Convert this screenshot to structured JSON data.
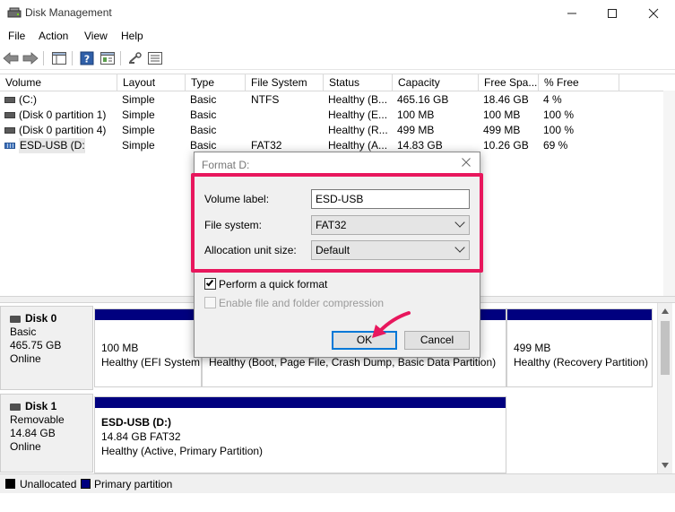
{
  "window": {
    "title": "Disk Management",
    "controls": [
      "minimize",
      "maximize",
      "close"
    ]
  },
  "menu": [
    "File",
    "Action",
    "View",
    "Help"
  ],
  "toolbar": {
    "icons": [
      "back-icon",
      "forward-icon",
      "console-tree-icon",
      "help-icon",
      "properties-icon",
      "key-icon",
      "list-view-icon"
    ]
  },
  "volume_list": {
    "columns": [
      "Volume",
      "Layout",
      "Type",
      "File System",
      "Status",
      "Capacity",
      "Free Spa...",
      "% Free"
    ],
    "rows": [
      {
        "volume": "(C:)",
        "layout": "Simple",
        "type": "Basic",
        "fs": "NTFS",
        "status": "Healthy (B...",
        "capacity": "465.16 GB",
        "free": "18.46 GB",
        "pct": "4 %"
      },
      {
        "volume": "(Disk 0 partition 1)",
        "layout": "Simple",
        "type": "Basic",
        "fs": "",
        "status": "Healthy (E...",
        "capacity": "100 MB",
        "free": "100 MB",
        "pct": "100 %"
      },
      {
        "volume": "(Disk 0 partition 4)",
        "layout": "Simple",
        "type": "Basic",
        "fs": "",
        "status": "Healthy (R...",
        "capacity": "499 MB",
        "free": "499 MB",
        "pct": "100 %"
      },
      {
        "volume": "ESD-USB (D:)",
        "layout": "Simple",
        "type": "Basic",
        "fs": "FAT32",
        "status": "Healthy (A...",
        "capacity": "14.83 GB",
        "free": "10.26 GB",
        "pct": "69 %"
      }
    ]
  },
  "disks": [
    {
      "name": "Disk 0",
      "type": "Basic",
      "size": "465.75 GB",
      "state": "Online",
      "partitions": [
        {
          "title": "",
          "line1": "100 MB",
          "line2": "Healthy (EFI System"
        },
        {
          "title": "",
          "line1": "",
          "line2": "Healthy (Boot, Page File, Crash Dump, Basic Data Partition)"
        },
        {
          "title": "",
          "line1": "499 MB",
          "line2": "Healthy (Recovery Partition)"
        }
      ]
    },
    {
      "name": "Disk 1",
      "type": "Removable",
      "size": "14.84 GB",
      "state": "Online",
      "partitions": [
        {
          "title": "ESD-USB  (D:)",
          "line1": "14.84 GB FAT32",
          "line2": "Healthy (Active, Primary Partition)"
        }
      ]
    }
  ],
  "legend": [
    {
      "label": "Unallocated",
      "color": "#000000"
    },
    {
      "label": "Primary partition",
      "color": "#00007f"
    }
  ],
  "dialog": {
    "title": "Format D:",
    "volume_label_label": "Volume label:",
    "volume_label_value": "ESD-USB",
    "file_system_label": "File system:",
    "file_system_value": "FAT32",
    "allocation_label": "Allocation unit size:",
    "allocation_value": "Default",
    "quick_format_label": "Perform a quick format",
    "quick_format_checked": true,
    "compression_label": "Enable file and folder compression",
    "compression_enabled": false,
    "ok_label": "OK",
    "cancel_label": "Cancel"
  },
  "colors": {
    "highlight": "#e8175d",
    "primary_partition": "#00007f",
    "focus": "#0078d7"
  }
}
